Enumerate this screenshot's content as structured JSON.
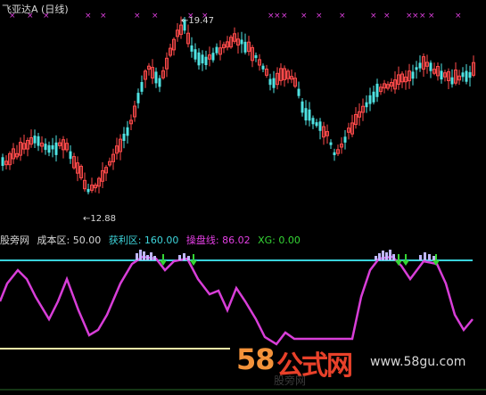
{
  "main_chart": {
    "title": "飞亚达A (日线)",
    "high_label": "19.47",
    "low_label": "12.88",
    "colors": {
      "up": "#ff4a4a",
      "down": "#4fe3e3",
      "marker": "#dd3fdd"
    }
  },
  "indicator": {
    "name": "股旁网",
    "cost_label": "成本区: 50.00",
    "profit_label": "获利区: 160.00",
    "operation_label": "操盘线: 86.02",
    "xg_label": "XG: 0.00",
    "colors": {
      "level_line": "#39d3dc",
      "operation_line": "#d83ed8",
      "signal_arrow": "#35d635",
      "bar": "#bfb6ff",
      "cost_line": "#f4e9a8"
    }
  },
  "watermark": {
    "number": "58",
    "text": "公式网",
    "url": "www.58gu.com",
    "faint": "股旁网"
  }
}
